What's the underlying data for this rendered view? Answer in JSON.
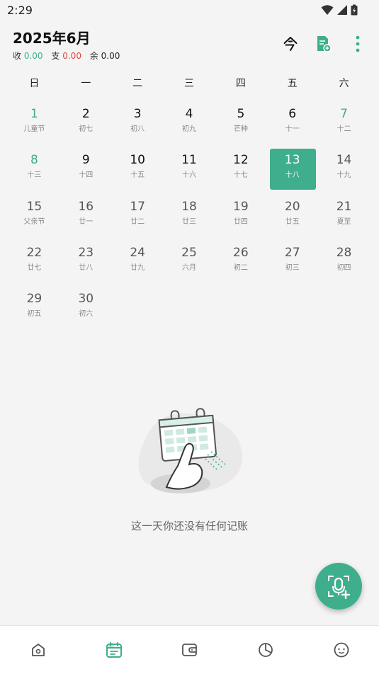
{
  "status": {
    "time": "2:29"
  },
  "header": {
    "title": "2025年6月",
    "income_label": "收",
    "income_value": "0.00",
    "expense_label": "支",
    "expense_value": "0.00",
    "balance_label": "余",
    "balance_value": "0.00"
  },
  "weekdays": [
    "日",
    "一",
    "二",
    "三",
    "四",
    "五",
    "六"
  ],
  "days": [
    {
      "day": "1",
      "lunar": "儿童节"
    },
    {
      "day": "2",
      "lunar": "初七"
    },
    {
      "day": "3",
      "lunar": "初八"
    },
    {
      "day": "4",
      "lunar": "初九"
    },
    {
      "day": "5",
      "lunar": "芒种"
    },
    {
      "day": "6",
      "lunar": "十一"
    },
    {
      "day": "7",
      "lunar": "十二"
    },
    {
      "day": "8",
      "lunar": "十三"
    },
    {
      "day": "9",
      "lunar": "十四"
    },
    {
      "day": "10",
      "lunar": "十五"
    },
    {
      "day": "11",
      "lunar": "十六"
    },
    {
      "day": "12",
      "lunar": "十七"
    },
    {
      "day": "13",
      "lunar": "十八"
    },
    {
      "day": "14",
      "lunar": "十九"
    },
    {
      "day": "15",
      "lunar": "父亲节"
    },
    {
      "day": "16",
      "lunar": "廿一"
    },
    {
      "day": "17",
      "lunar": "廿二"
    },
    {
      "day": "18",
      "lunar": "廿三"
    },
    {
      "day": "19",
      "lunar": "廿四"
    },
    {
      "day": "20",
      "lunar": "廿五"
    },
    {
      "day": "21",
      "lunar": "夏至"
    },
    {
      "day": "22",
      "lunar": "廿七"
    },
    {
      "day": "23",
      "lunar": "廿八"
    },
    {
      "day": "24",
      "lunar": "廿九"
    },
    {
      "day": "25",
      "lunar": "六月"
    },
    {
      "day": "26",
      "lunar": "初二"
    },
    {
      "day": "27",
      "lunar": "初三"
    },
    {
      "day": "28",
      "lunar": "初四"
    },
    {
      "day": "29",
      "lunar": "初五"
    },
    {
      "day": "30",
      "lunar": "初六"
    }
  ],
  "selected_day": "13",
  "empty_message": "这一天你还没有任何记账",
  "colors": {
    "accent": "#3fae8c",
    "expense": "#e0473e"
  },
  "icons": {
    "header": [
      "today-icon",
      "add-record-icon",
      "more-vert-icon"
    ],
    "fab": "voice-add-icon",
    "nav": [
      "home-icon",
      "calendar-icon",
      "wallet-icon",
      "chart-icon",
      "profile-icon"
    ]
  }
}
